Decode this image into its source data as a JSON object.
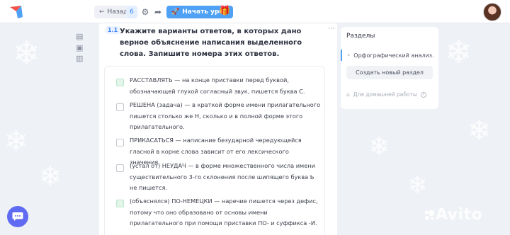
{
  "topbar": {
    "back_label": "Назад",
    "count": "6",
    "start_label": "Начать урок"
  },
  "task": {
    "number": "1.1",
    "title": "Укажите варианты ответов, в которых дано верное объяснение написания выделенного слова. Запишите номера этих ответов.",
    "options": [
      {
        "text": "РАССТАВЛЯТЬ — на конце приставки перед буквой, обозначающей глухой согласный звук, пишется буква С.",
        "checkbox_color": "green"
      },
      {
        "text": "РЕШЕНА (задача) — в краткой форме имени прилагательного пишется столько же Н, сколько и в полной форме этого прилагательного.",
        "checkbox_color": "white"
      },
      {
        "text": "ПРИКАСАТЬСЯ — написание безударной чередующейся гласной в корне слова зависит от его лексического значения.",
        "checkbox_color": "white"
      },
      {
        "text": "(устал от) НЕУДАЧ — в форме множественного числа имени существительного 3-го склонения после шипящего буква Ь не пишется.",
        "checkbox_color": "white"
      },
      {
        "text": "(объяснялся) ПО-НЕМЕЦКИ — наречие пишется через дефис, потому что оно образовано от основы имени прилагательного при помощи приставки ПО- и суффикса -И.",
        "checkbox_color": "green"
      }
    ]
  },
  "sidebar": {
    "title": "Разделы",
    "section_item": "Орфографический анализ.",
    "create_button": "Создать новый раздел",
    "homework_label": "Для домашней работы"
  },
  "watermark": "Avito",
  "colors": {
    "accent": "#4ea1f5",
    "chat_fab": "#5f6bf2",
    "checkbox_green": "#e4f6ea"
  }
}
